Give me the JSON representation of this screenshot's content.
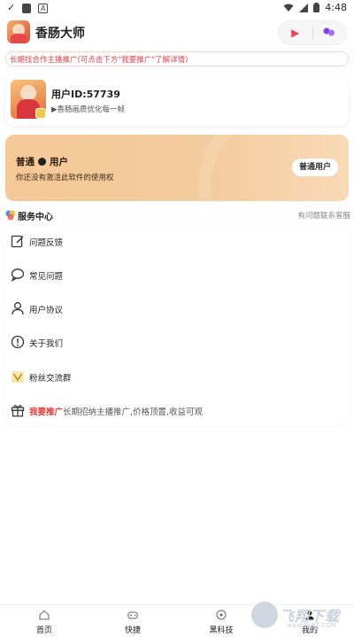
{
  "status_bar": {
    "time": "4:48",
    "icons": [
      "check-icon",
      "app-square-icon",
      "a-icon",
      "wifi-icon",
      "signal-icon",
      "battery-icon"
    ]
  },
  "header": {
    "title": "香肠大师",
    "play_icon": "▶",
    "menu_icon": "●●"
  },
  "notice": {
    "text": "长期找合作主播推广(可点击下方\"我要推广\"了解详情)"
  },
  "user": {
    "id_label": "用户ID:57739",
    "subtitle": "▶香肠画质优化每一帧"
  },
  "membership": {
    "level_prefix": "普通",
    "level_suffix": "用户",
    "description": "你还没有激活此软件的使用权",
    "button_label": "普通用户"
  },
  "service": {
    "title": "服务中心",
    "contact": "有问题联系客服",
    "items": [
      {
        "label": "问题反馈",
        "icon": "edit-icon"
      },
      {
        "label": "常见问题",
        "icon": "chat-icon"
      },
      {
        "label": "用户协议",
        "icon": "user-icon"
      },
      {
        "label": "关于我们",
        "icon": "info-icon"
      },
      {
        "label": "粉丝交流群",
        "icon": "crown-icon"
      }
    ],
    "promo": {
      "hot": "我要推广",
      "rest": "长期招纳主播推广,价格顶置,收益可观",
      "icon": "gift-icon"
    }
  },
  "bottom_nav": [
    {
      "label": "首页",
      "icon": "home-icon"
    },
    {
      "label": "快捷",
      "icon": "gamepad-icon"
    },
    {
      "label": "黑科技",
      "icon": "compass-icon"
    },
    {
      "label": "我的",
      "icon": "profile-icon"
    }
  ],
  "watermark": {
    "text": "飞翔下载",
    "url": "www.FXXZ.COM"
  },
  "colors": {
    "accent_red": "#e0424b",
    "banner_gold": "#f6c898",
    "purple": "#7b3fe4"
  }
}
